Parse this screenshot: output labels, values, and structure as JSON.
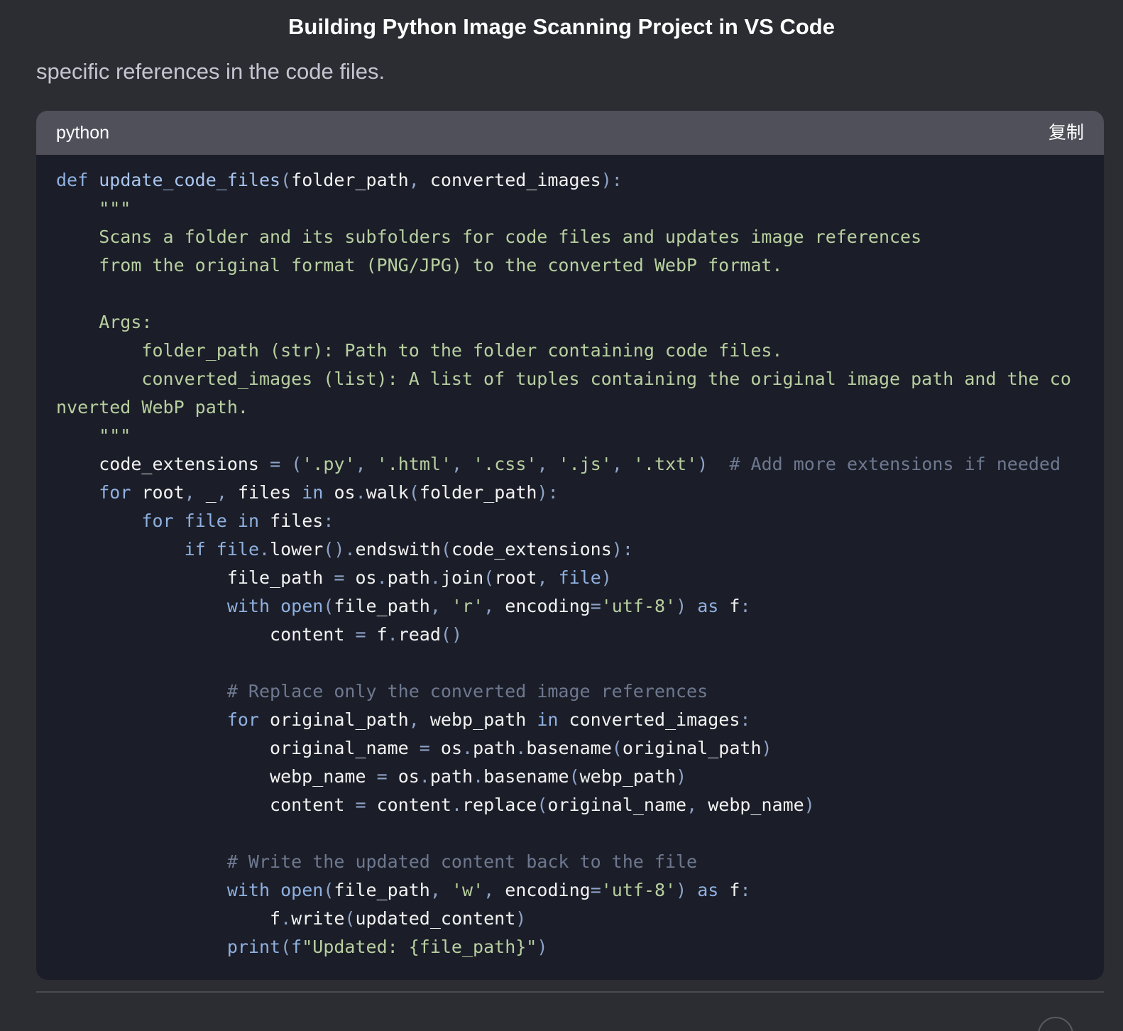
{
  "header": {
    "title": "Building Python Image Scanning Project in VS Code"
  },
  "message": {
    "intro_text": "specific references in the code files."
  },
  "code_block": {
    "language": "python",
    "copy_label": "复制",
    "lines": [
      "def update_code_files(folder_path, converted_images):",
      "    \"\"\"",
      "    Scans a folder and its subfolders for code files and updates image references",
      "    from the original format (PNG/JPG) to the converted WebP format.",
      "",
      "    Args:",
      "        folder_path (str): Path to the folder containing code files.",
      "        converted_images (list): A list of tuples containing the original image path and the co",
      "nverted WebP path.",
      "    \"\"\"",
      "    code_extensions = ('.py', '.html', '.css', '.js', '.txt')  # Add more extensions if needed",
      "    for root, _, files in os.walk(folder_path):",
      "        for file in files:",
      "            if file.lower().endswith(code_extensions):",
      "                file_path = os.path.join(root, file)",
      "                with open(file_path, 'r', encoding='utf-8') as f:",
      "                    content = f.read()",
      "",
      "                # Replace only the converted image references",
      "                for original_path, webp_path in converted_images:",
      "                    original_name = os.path.basename(original_path)",
      "                    webp_name = os.path.basename(webp_path)",
      "                    content = content.replace(original_name, webp_name)",
      "",
      "                # Write the updated content back to the file",
      "                with open(file_path, 'w', encoding='utf-8') as f:",
      "                    f.write(updated_content)",
      "                print(f\"Updated: {file_path}\")"
    ]
  },
  "colors": {
    "page_background": "#2c2d32",
    "code_background": "#1b1e28",
    "code_header_background": "#4f5059",
    "keyword": "#8fb0e0",
    "string": "#b8cfa0",
    "comment": "#6e7890"
  }
}
